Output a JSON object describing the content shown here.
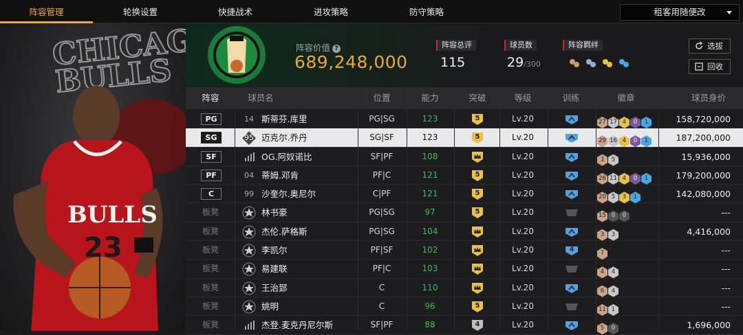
{
  "tabs": [
    {
      "label": "阵容管理",
      "active": true
    },
    {
      "label": "轮换设置",
      "active": false
    },
    {
      "label": "快捷战术",
      "active": false
    },
    {
      "label": "进攻策略",
      "active": false
    },
    {
      "label": "防守策略",
      "active": false
    }
  ],
  "mode_select": {
    "value": "租客用随便改"
  },
  "team": {
    "value_label": "阵容价值",
    "value": "689,248,000",
    "overall_label": "阵容总评",
    "overall": "115",
    "count_label": "球员数",
    "count": "29",
    "count_max": "/300",
    "bond_label": "阵容羁绊"
  },
  "buttons": {
    "select": "选拔",
    "recycle": "回收"
  },
  "columns": [
    "阵容",
    "球员名",
    "位置",
    "能力",
    "突破",
    "等级",
    "训练",
    "徽章",
    "球员身价"
  ],
  "rows": [
    {
      "pos": "PG",
      "jersey": "14",
      "name": "斯蒂芬.库里",
      "position": "PG|SG",
      "ability": "123",
      "breakthrough": "5",
      "level": "Lv.20",
      "train": "up",
      "badges": [
        [
          "27",
          "b-bronze"
        ],
        [
          "17",
          "b-silver"
        ],
        [
          "4",
          "b-gold"
        ],
        [
          "0",
          "b-purple"
        ],
        [
          "1",
          "b-blue"
        ]
      ],
      "price": "158,720,000",
      "selected": false
    },
    {
      "pos": "SG",
      "jersey": "95",
      "name": "迈克尔.乔丹",
      "position": "SG|SF",
      "ability": "123",
      "breakthrough": "5",
      "level": "Lv.20",
      "train": "up",
      "badges": [
        [
          "29",
          "b-bronze"
        ],
        [
          "16",
          "b-silver"
        ],
        [
          "4",
          "b-gold"
        ],
        [
          "0",
          "b-purple"
        ],
        [
          "1",
          "b-blue"
        ]
      ],
      "price": "187,200,000",
      "selected": true
    },
    {
      "pos": "SF",
      "jersey": "bars",
      "name": "OG.阿奴诺比",
      "position": "SF|PF",
      "ability": "108",
      "breakthrough": "crown",
      "level": "Lv.20",
      "train": "up",
      "badges": [
        [
          "3",
          "b-bronze"
        ],
        [
          "5",
          "b-silver"
        ]
      ],
      "price": "15,936,000",
      "selected": false
    },
    {
      "pos": "PF",
      "jersey": "04",
      "name": "蒂姆.邓肯",
      "position": "PF|C",
      "ability": "121",
      "breakthrough": "5",
      "level": "Lv.20",
      "train": "up",
      "badges": [
        [
          "26",
          "b-bronze"
        ],
        [
          "11",
          "b-silver"
        ],
        [
          "4",
          "b-gold"
        ],
        [
          "0",
          "b-purple"
        ],
        [
          "1",
          "b-blue"
        ]
      ],
      "price": "179,200,000",
      "selected": false
    },
    {
      "pos": "C",
      "jersey": "99",
      "name": "沙奎尔.奥尼尔",
      "position": "C|PF",
      "ability": "121",
      "breakthrough": "5",
      "level": "Lv.20",
      "train": "up",
      "badges": [
        [
          "20",
          "b-bronze"
        ],
        [
          "5",
          "b-silver"
        ],
        [
          "3",
          "b-gold"
        ],
        [
          "1",
          "b-blue"
        ]
      ],
      "price": "142,080,000",
      "selected": false
    },
    {
      "pos": "板凳",
      "jersey": "star",
      "name": "林书豪",
      "position": "PG|SG",
      "ability": "97",
      "breakthrough": "5",
      "level": "Lv.20",
      "train": "dash",
      "badges": [
        [
          "15",
          "b-bronze"
        ],
        [
          "0",
          "b-dark"
        ],
        [
          "0",
          "b-dark"
        ]
      ],
      "price": "---",
      "selected": false
    },
    {
      "pos": "板凳",
      "jersey": "star",
      "name": "杰伦.萨格斯",
      "position": "PG|SG",
      "ability": "104",
      "breakthrough": "crown",
      "level": "Lv.20",
      "train": "up",
      "badges": [
        [
          "3",
          "b-bronze"
        ],
        [
          "3",
          "b-silver"
        ]
      ],
      "price": "4,416,000",
      "selected": false
    },
    {
      "pos": "板凳",
      "jersey": "star",
      "name": "李凯尔",
      "position": "PF|SF",
      "ability": "102",
      "breakthrough": "crown",
      "level": "Lv.20",
      "train": "4",
      "badges": [
        [
          "7",
          "b-bronze"
        ]
      ],
      "price": "---",
      "selected": false
    },
    {
      "pos": "板凳",
      "jersey": "star",
      "name": "易建联",
      "position": "PF|C",
      "ability": "103",
      "breakthrough": "crown",
      "level": "Lv.20",
      "train": "dash",
      "badges": [
        [
          "4",
          "b-bronze"
        ],
        [
          "4",
          "b-silver"
        ]
      ],
      "price": "---",
      "selected": false
    },
    {
      "pos": "板凳",
      "jersey": "star",
      "name": "王治郅",
      "position": "C",
      "ability": "110",
      "breakthrough": "crown",
      "level": "Lv.20",
      "train": "up",
      "badges": [
        [
          "6",
          "b-bronze"
        ],
        [
          "4",
          "b-silver"
        ]
      ],
      "price": "---",
      "selected": false
    },
    {
      "pos": "板凳",
      "jersey": "star",
      "name": "姚明",
      "position": "C",
      "ability": "96",
      "breakthrough": "5",
      "level": "Lv.20",
      "train": "dash",
      "badges": [
        [
          "11",
          "b-bronze"
        ],
        [
          "1",
          "b-silver"
        ]
      ],
      "price": "---",
      "selected": false
    },
    {
      "pos": "板凳",
      "jersey": "bars",
      "name": "杰登.麦克丹尼尔斯",
      "position": "SF|PF",
      "ability": "88",
      "breakthrough": "4",
      "level": "Lv.20",
      "train": "up",
      "badges": [
        [
          "5",
          "b-bronze"
        ],
        [
          "0",
          "b-dark"
        ]
      ],
      "price": "1,696,000",
      "selected": false
    }
  ]
}
